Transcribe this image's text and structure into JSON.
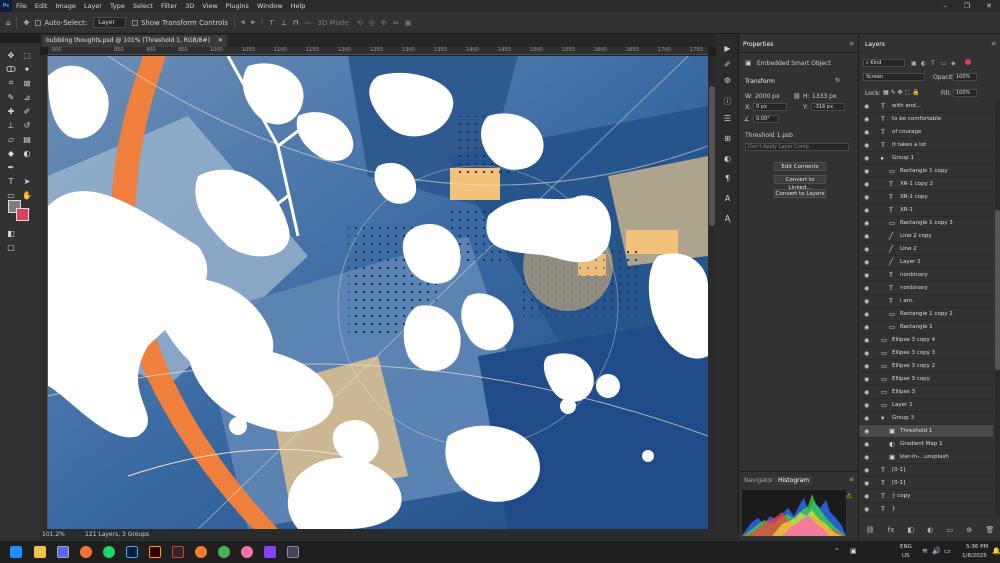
{
  "menubar": {
    "logo": "Ps",
    "items": [
      "File",
      "Edit",
      "Image",
      "Layer",
      "Type",
      "Select",
      "Filter",
      "3D",
      "View",
      "Plugins",
      "Window",
      "Help"
    ]
  },
  "window_controls": [
    "–",
    "❐",
    "✕"
  ],
  "options": {
    "auto_select_label": "Auto-Select:",
    "auto_select_value": "Layer",
    "show_transform_label": "Show Transform Controls",
    "mode_3d_label": "3D Mode:"
  },
  "document": {
    "tab_title": "bubbling thoughts.psd @ 101% (Threshold 1, RGB/8#)",
    "zoom": "101.2%",
    "status": "121 Layers, 3 Groups",
    "ruler_labels": [
      "-500",
      "850",
      "900",
      "950",
      "1000",
      "1050",
      "1100",
      "1150",
      "1200",
      "1250",
      "1300",
      "1350",
      "1400",
      "1450",
      "1500",
      "1550",
      "1600",
      "1650",
      "1700",
      "1750"
    ]
  },
  "properties": {
    "tab": "Properties",
    "object_type": "Embedded Smart Object",
    "section_transform": "Transform",
    "w_label": "W:",
    "w_value": "2000 px",
    "h_label": "H:",
    "h_value": "1333 px",
    "x_label": "X:",
    "x_value": "0 px",
    "y_label": "Y:",
    "y_value": "-316 px",
    "angle_value": "0.00°",
    "file_name": "Threshold 1.psb",
    "layer_comp": "Don't Apply Layer Comp",
    "btn_edit": "Edit Contents",
    "btn_convert_linked": "Convert to Linked...",
    "btn_convert_layers": "Convert to Layers"
  },
  "bottom_tabs": {
    "navigator": "Navigator",
    "histogram": "Histogram"
  },
  "layers": {
    "tab": "Layers",
    "filter_kind": "Kind",
    "blend_mode": "Screen",
    "opacity_label": "Opacity:",
    "opacity_value": "100%",
    "lock_label": "Lock:",
    "fill_label": "Fill:",
    "fill_value": "100%",
    "rows": [
      {
        "icon": "T",
        "name": "with and...",
        "indent": 0
      },
      {
        "icon": "T",
        "name": "to be comfortable",
        "indent": 0
      },
      {
        "icon": "T",
        "name": "of courage",
        "indent": 0
      },
      {
        "icon": "T",
        "name": "it takes a lot",
        "indent": 0
      },
      {
        "icon": "▸",
        "name": "Group 1",
        "indent": 0
      },
      {
        "icon": "▭",
        "name": "Rectangle 1 copy",
        "indent": 1
      },
      {
        "icon": "T",
        "name": "XR-1 copy 2",
        "indent": 1
      },
      {
        "icon": "T",
        "name": "XR-1 copy",
        "indent": 1
      },
      {
        "icon": "T",
        "name": "XR-1",
        "indent": 1
      },
      {
        "icon": "▭",
        "name": "Rectangle 1 copy 3",
        "indent": 1
      },
      {
        "icon": "╱",
        "name": "Line 2 copy",
        "indent": 1
      },
      {
        "icon": "╱",
        "name": "Line 2",
        "indent": 1
      },
      {
        "icon": "╱",
        "name": "Layer 2",
        "indent": 1
      },
      {
        "icon": "T",
        "name": "nonbinary",
        "indent": 1
      },
      {
        "icon": "T",
        "name": "nonbinary",
        "indent": 1
      },
      {
        "icon": "T",
        "name": "i am.",
        "indent": 1
      },
      {
        "icon": "▭",
        "name": "Rectangle 1 copy 2",
        "indent": 1
      },
      {
        "icon": "▭",
        "name": "Rectangle 1",
        "indent": 1
      },
      {
        "icon": "▭",
        "name": "Ellipse 3 copy 4",
        "indent": 0
      },
      {
        "icon": "▭",
        "name": "Ellipse 3 copy 3",
        "indent": 0
      },
      {
        "icon": "▭",
        "name": "Ellipse 3 copy 2",
        "indent": 0
      },
      {
        "icon": "▭",
        "name": "Ellipse 3 copy",
        "indent": 0
      },
      {
        "icon": "▭",
        "name": "Ellipse 3",
        "indent": 0
      },
      {
        "icon": "▭",
        "name": "Layer 1",
        "indent": 0
      },
      {
        "icon": "▾",
        "name": "Group 3",
        "indent": 0
      },
      {
        "icon": "▣",
        "name": "Threshold 1",
        "indent": 1,
        "selected": true
      },
      {
        "icon": "◐",
        "name": "Gradient Map 1",
        "indent": 1
      },
      {
        "icon": "▣",
        "name": "kier-in-...unsplash",
        "indent": 1
      },
      {
        "icon": "T",
        "name": "[0-1]",
        "indent": 0
      },
      {
        "icon": "T",
        "name": "[0-1]",
        "indent": 0
      },
      {
        "icon": "T",
        "name": "} copy",
        "indent": 0
      },
      {
        "icon": "T",
        "name": "}",
        "indent": 0
      },
      {
        "icon": "T",
        "name": "{",
        "indent": 0
      }
    ]
  },
  "taskbar": {
    "lang1": "ENG",
    "lang2": "US",
    "time": "5:36 PM",
    "date": "1/8/2025"
  }
}
